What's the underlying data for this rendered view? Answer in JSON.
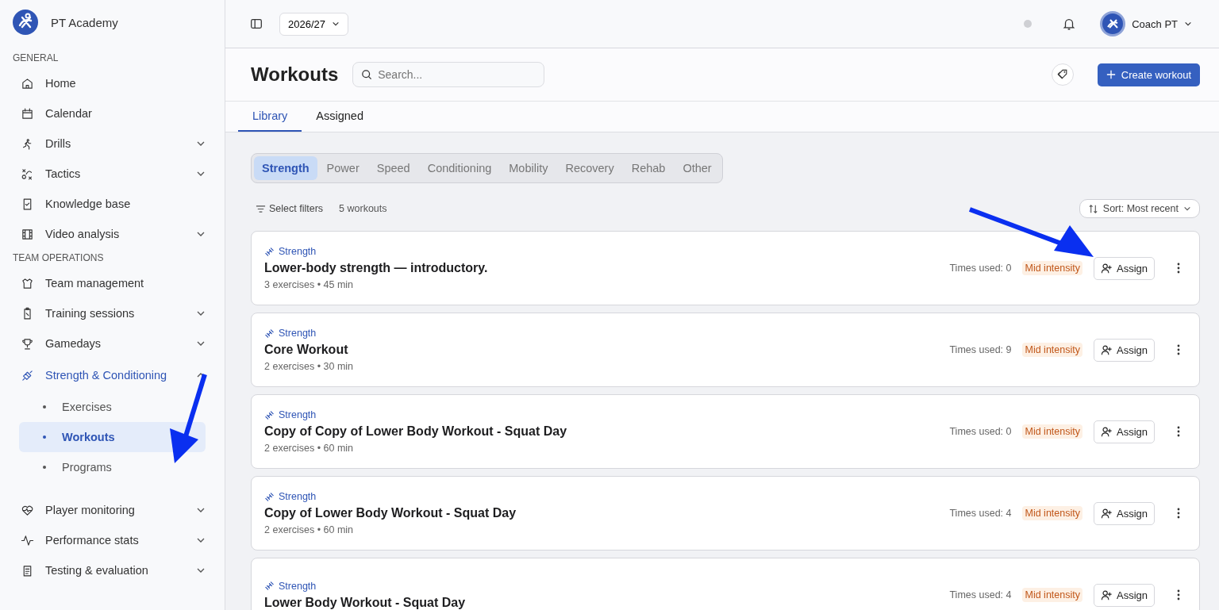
{
  "brand": {
    "name": "PT Academy"
  },
  "sidebar": {
    "sections": [
      {
        "heading": "GENERAL",
        "items": [
          {
            "label": "Home",
            "selected": false
          },
          {
            "label": "Calendar",
            "selected": false
          },
          {
            "label": "Drills",
            "selected": false,
            "expanded": false
          },
          {
            "label": "Tactics",
            "selected": false,
            "expanded": false
          },
          {
            "label": "Knowledge base",
            "selected": false
          },
          {
            "label": "Video analysis",
            "selected": false,
            "expanded": false
          }
        ]
      },
      {
        "heading": "TEAM OPERATIONS",
        "items": [
          {
            "label": "Team management",
            "selected": false
          },
          {
            "label": "Training sessions",
            "selected": false,
            "expanded": false
          },
          {
            "label": "Gamedays",
            "selected": false,
            "expanded": false
          },
          {
            "label": "Strength & Conditioning",
            "selected": true,
            "expanded": true,
            "children": [
              {
                "label": "Exercises",
                "selected": false
              },
              {
                "label": "Workouts",
                "selected": true
              },
              {
                "label": "Programs",
                "selected": false
              }
            ]
          },
          {
            "label": "Player monitoring",
            "selected": false,
            "expanded": false
          },
          {
            "label": "Performance stats",
            "selected": false,
            "expanded": false
          },
          {
            "label": "Testing & evaluation",
            "selected": false,
            "expanded": false
          }
        ]
      }
    ]
  },
  "topbar": {
    "season": "2026/27",
    "user": "Coach PT"
  },
  "page": {
    "title": "Workouts",
    "search": {
      "placeholder": "Search..."
    },
    "create_button": "Create workout"
  },
  "tabs": [
    {
      "label": "Library",
      "selected": true
    },
    {
      "label": "Assigned",
      "selected": false
    }
  ],
  "categories": [
    {
      "label": "Strength",
      "selected": true
    },
    {
      "label": "Power",
      "selected": false
    },
    {
      "label": "Speed",
      "selected": false
    },
    {
      "label": "Conditioning",
      "selected": false
    },
    {
      "label": "Mobility",
      "selected": false
    },
    {
      "label": "Recovery",
      "selected": false
    },
    {
      "label": "Rehab",
      "selected": false
    },
    {
      "label": "Other",
      "selected": false
    }
  ],
  "filters": {
    "label": "Select filters",
    "count": "5 workouts",
    "sort": "Sort: Most recent"
  },
  "workouts": [
    {
      "category": "Strength",
      "title": "Lower-body strength — introductory.",
      "meta": "3 exercises • 45 min",
      "used": "Times used: 0",
      "intensity": "Mid intensity",
      "action": "Assign"
    },
    {
      "category": "Strength",
      "title": "Core Workout",
      "meta": "2 exercises • 30 min",
      "used": "Times used: 9",
      "intensity": "Mid intensity",
      "action": "Assign"
    },
    {
      "category": "Strength",
      "title": "Copy of Copy of Lower Body Workout - Squat Day",
      "meta": "2 exercises • 60 min",
      "used": "Times used: 0",
      "intensity": "Mid intensity",
      "action": "Assign"
    },
    {
      "category": "Strength",
      "title": "Copy of Lower Body Workout - Squat Day",
      "meta": "2 exercises • 60 min",
      "used": "Times used: 4",
      "intensity": "Mid intensity",
      "action": "Assign"
    },
    {
      "category": "Strength",
      "title": "Lower Body Workout - Squat Day",
      "used": "Times used: 4",
      "intensity": "Mid intensity",
      "action": "Assign"
    }
  ]
}
